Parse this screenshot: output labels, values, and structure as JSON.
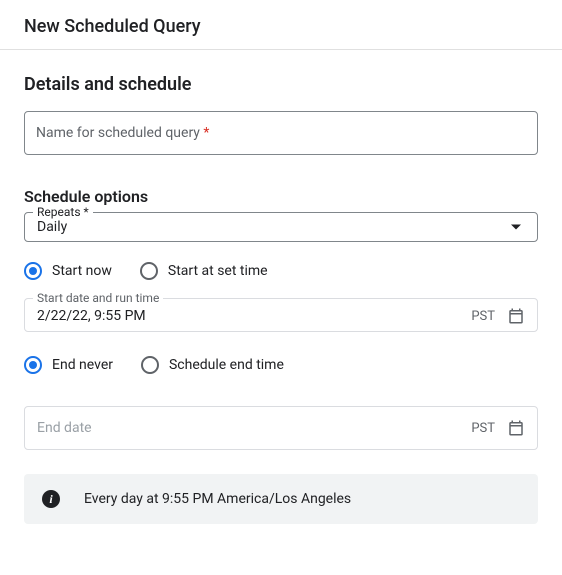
{
  "header": {
    "title": "New Scheduled Query"
  },
  "details": {
    "sectionTitle": "Details and schedule",
    "nameLabel": "Name for scheduled query",
    "nameValue": ""
  },
  "schedule": {
    "sectionTitle": "Schedule options",
    "repeatsLabel": "Repeats",
    "repeatsValue": "Daily",
    "startNowLabel": "Start now",
    "startAtLabel": "Start at set time",
    "startSelected": "now",
    "startDateLabel": "Start date and run time",
    "startDateValue": "2/22/22, 9:55 PM",
    "startTz": "PST",
    "endNeverLabel": "End never",
    "endTimeLabel": "Schedule end time",
    "endSelected": "never",
    "endDatePlaceholder": "End date",
    "endDateValue": "",
    "endTz": "PST"
  },
  "summary": {
    "text": "Every day at 9:55 PM America/Los Angeles"
  }
}
